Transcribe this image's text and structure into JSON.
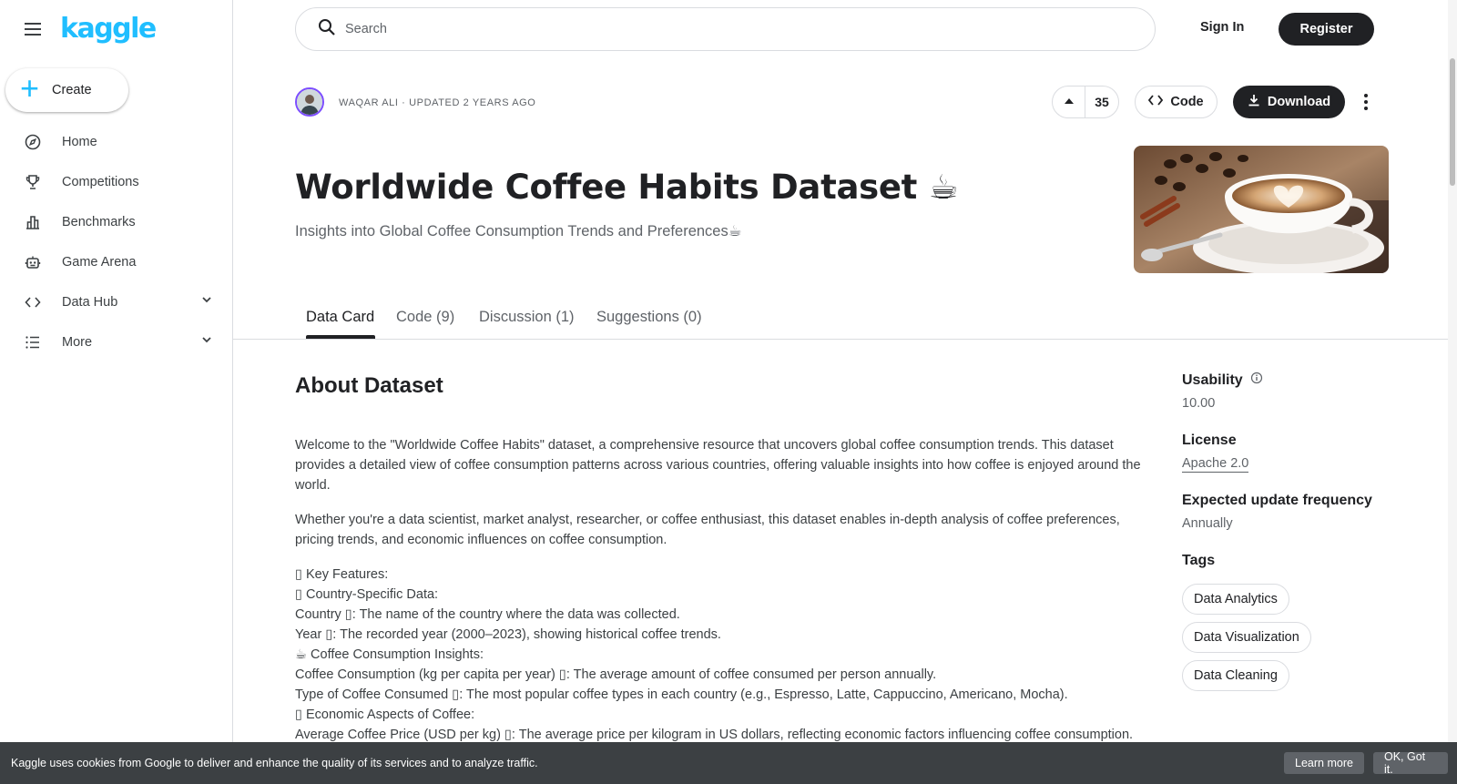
{
  "sidebar": {
    "logo": "kaggle",
    "create_label": "Create",
    "items": [
      {
        "label": "Home",
        "icon": "compass-icon"
      },
      {
        "label": "Competitions",
        "icon": "trophy-icon"
      },
      {
        "label": "Benchmarks",
        "icon": "bar-chart-icon"
      },
      {
        "label": "Game Arena",
        "icon": "robot-icon"
      },
      {
        "label": "Data Hub",
        "icon": "code-brackets-icon",
        "expandable": true
      },
      {
        "label": "More",
        "icon": "list-icon",
        "expandable": true
      }
    ]
  },
  "topbar": {
    "search_placeholder": "Search",
    "signin_label": "Sign In",
    "register_label": "Register"
  },
  "header": {
    "byline": "WAQAR ALI · UPDATED 2 YEARS AGO",
    "vote_count": "35",
    "code_label": "Code",
    "download_label": "Download",
    "title": "Worldwide Coffee Habits Dataset ☕",
    "subtitle": "Insights into Global Coffee Consumption Trends and Preferences☕"
  },
  "tabs": [
    {
      "label": "Data Card",
      "active": true
    },
    {
      "label": "Code (9)",
      "active": false
    },
    {
      "label": "Discussion (1)",
      "active": false
    },
    {
      "label": "Suggestions (0)",
      "active": false
    }
  ],
  "about": {
    "heading": "About Dataset",
    "para1": "Welcome to the \"Worldwide Coffee Habits\" dataset, a comprehensive resource that uncovers global coffee consumption trends. This dataset provides a detailed view of coffee consumption patterns across various countries, offering valuable insights into how coffee is enjoyed around the world.",
    "para2": "Whether you're a data scientist, market analyst, researcher, or coffee enthusiast, this dataset enables in-depth analysis of coffee preferences, pricing trends, and economic influences on coffee consumption.",
    "lines": [
      "▯ Key Features:",
      "▯ Country-Specific Data:",
      "Country ▯: The name of the country where the data was collected.",
      "Year ▯: The recorded year (2000–2023), showing historical coffee trends.",
      "☕ Coffee Consumption Insights:",
      "Coffee Consumption (kg per capita per year) ▯: The average amount of coffee consumed per person annually.",
      "Type of Coffee Consumed ▯: The most popular coffee types in each country (e.g., Espresso, Latte, Cappuccino, Americano, Mocha).",
      "▯ Economic Aspects of Coffee:",
      "Average Coffee Price (USD per kg) ▯: The average price per kilogram in US dollars, reflecting economic factors influencing coffee consumption."
    ]
  },
  "meta": {
    "usability_label": "Usability",
    "usability_value": "10.00",
    "license_label": "License",
    "license_value": "Apache 2.0",
    "frequency_label": "Expected update frequency",
    "frequency_value": "Annually",
    "tags_label": "Tags",
    "tags": [
      "Data Analytics",
      "Data Visualization",
      "Data Cleaning"
    ]
  },
  "cookie": {
    "message": "Kaggle uses cookies from Google to deliver and enhance the quality of its services and to analyze traffic.",
    "learn_more": "Learn more",
    "ok": "OK, Got it."
  },
  "colors": {
    "brand": "#20beff",
    "dark": "#202124",
    "avatar_ring": "#7c4dff"
  }
}
